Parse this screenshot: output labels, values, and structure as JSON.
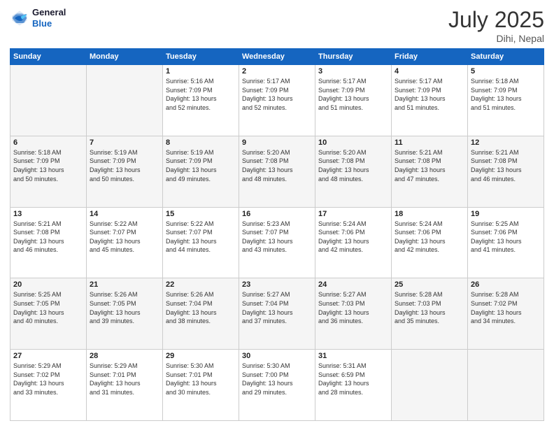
{
  "header": {
    "logo_line1": "General",
    "logo_line2": "Blue",
    "month": "July 2025",
    "location": "Dihi, Nepal"
  },
  "weekdays": [
    "Sunday",
    "Monday",
    "Tuesday",
    "Wednesday",
    "Thursday",
    "Friday",
    "Saturday"
  ],
  "weeks": [
    [
      {
        "day": "",
        "info": ""
      },
      {
        "day": "",
        "info": ""
      },
      {
        "day": "1",
        "info": "Sunrise: 5:16 AM\nSunset: 7:09 PM\nDaylight: 13 hours\nand 52 minutes."
      },
      {
        "day": "2",
        "info": "Sunrise: 5:17 AM\nSunset: 7:09 PM\nDaylight: 13 hours\nand 52 minutes."
      },
      {
        "day": "3",
        "info": "Sunrise: 5:17 AM\nSunset: 7:09 PM\nDaylight: 13 hours\nand 51 minutes."
      },
      {
        "day": "4",
        "info": "Sunrise: 5:17 AM\nSunset: 7:09 PM\nDaylight: 13 hours\nand 51 minutes."
      },
      {
        "day": "5",
        "info": "Sunrise: 5:18 AM\nSunset: 7:09 PM\nDaylight: 13 hours\nand 51 minutes."
      }
    ],
    [
      {
        "day": "6",
        "info": "Sunrise: 5:18 AM\nSunset: 7:09 PM\nDaylight: 13 hours\nand 50 minutes."
      },
      {
        "day": "7",
        "info": "Sunrise: 5:19 AM\nSunset: 7:09 PM\nDaylight: 13 hours\nand 50 minutes."
      },
      {
        "day": "8",
        "info": "Sunrise: 5:19 AM\nSunset: 7:09 PM\nDaylight: 13 hours\nand 49 minutes."
      },
      {
        "day": "9",
        "info": "Sunrise: 5:20 AM\nSunset: 7:08 PM\nDaylight: 13 hours\nand 48 minutes."
      },
      {
        "day": "10",
        "info": "Sunrise: 5:20 AM\nSunset: 7:08 PM\nDaylight: 13 hours\nand 48 minutes."
      },
      {
        "day": "11",
        "info": "Sunrise: 5:21 AM\nSunset: 7:08 PM\nDaylight: 13 hours\nand 47 minutes."
      },
      {
        "day": "12",
        "info": "Sunrise: 5:21 AM\nSunset: 7:08 PM\nDaylight: 13 hours\nand 46 minutes."
      }
    ],
    [
      {
        "day": "13",
        "info": "Sunrise: 5:21 AM\nSunset: 7:08 PM\nDaylight: 13 hours\nand 46 minutes."
      },
      {
        "day": "14",
        "info": "Sunrise: 5:22 AM\nSunset: 7:07 PM\nDaylight: 13 hours\nand 45 minutes."
      },
      {
        "day": "15",
        "info": "Sunrise: 5:22 AM\nSunset: 7:07 PM\nDaylight: 13 hours\nand 44 minutes."
      },
      {
        "day": "16",
        "info": "Sunrise: 5:23 AM\nSunset: 7:07 PM\nDaylight: 13 hours\nand 43 minutes."
      },
      {
        "day": "17",
        "info": "Sunrise: 5:24 AM\nSunset: 7:06 PM\nDaylight: 13 hours\nand 42 minutes."
      },
      {
        "day": "18",
        "info": "Sunrise: 5:24 AM\nSunset: 7:06 PM\nDaylight: 13 hours\nand 42 minutes."
      },
      {
        "day": "19",
        "info": "Sunrise: 5:25 AM\nSunset: 7:06 PM\nDaylight: 13 hours\nand 41 minutes."
      }
    ],
    [
      {
        "day": "20",
        "info": "Sunrise: 5:25 AM\nSunset: 7:05 PM\nDaylight: 13 hours\nand 40 minutes."
      },
      {
        "day": "21",
        "info": "Sunrise: 5:26 AM\nSunset: 7:05 PM\nDaylight: 13 hours\nand 39 minutes."
      },
      {
        "day": "22",
        "info": "Sunrise: 5:26 AM\nSunset: 7:04 PM\nDaylight: 13 hours\nand 38 minutes."
      },
      {
        "day": "23",
        "info": "Sunrise: 5:27 AM\nSunset: 7:04 PM\nDaylight: 13 hours\nand 37 minutes."
      },
      {
        "day": "24",
        "info": "Sunrise: 5:27 AM\nSunset: 7:03 PM\nDaylight: 13 hours\nand 36 minutes."
      },
      {
        "day": "25",
        "info": "Sunrise: 5:28 AM\nSunset: 7:03 PM\nDaylight: 13 hours\nand 35 minutes."
      },
      {
        "day": "26",
        "info": "Sunrise: 5:28 AM\nSunset: 7:02 PM\nDaylight: 13 hours\nand 34 minutes."
      }
    ],
    [
      {
        "day": "27",
        "info": "Sunrise: 5:29 AM\nSunset: 7:02 PM\nDaylight: 13 hours\nand 33 minutes."
      },
      {
        "day": "28",
        "info": "Sunrise: 5:29 AM\nSunset: 7:01 PM\nDaylight: 13 hours\nand 31 minutes."
      },
      {
        "day": "29",
        "info": "Sunrise: 5:30 AM\nSunset: 7:01 PM\nDaylight: 13 hours\nand 30 minutes."
      },
      {
        "day": "30",
        "info": "Sunrise: 5:30 AM\nSunset: 7:00 PM\nDaylight: 13 hours\nand 29 minutes."
      },
      {
        "day": "31",
        "info": "Sunrise: 5:31 AM\nSunset: 6:59 PM\nDaylight: 13 hours\nand 28 minutes."
      },
      {
        "day": "",
        "info": ""
      },
      {
        "day": "",
        "info": ""
      }
    ]
  ]
}
